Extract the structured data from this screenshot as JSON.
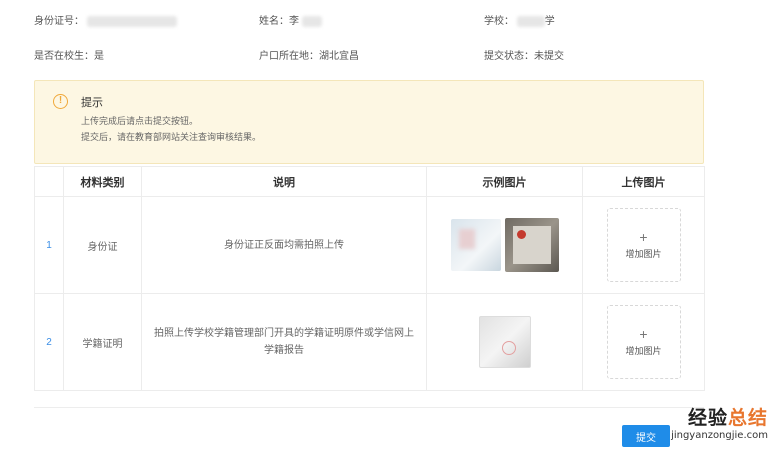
{
  "info": {
    "id_label": "身份证号：",
    "name_label": "姓名：",
    "name_value": "李",
    "school_label": "学校：",
    "school_value": "学",
    "enrolled_label": "是否在校生：",
    "enrolled_value": "是",
    "hukou_label": "户口所在地：",
    "hukou_value": "湖北宜昌",
    "status_label": "提交状态：",
    "status_value": "未提交"
  },
  "notice": {
    "icon": "exclamation-circle-icon",
    "title": "提示",
    "lines": [
      "上传完成后请点击提交按钮。",
      "提交后，请在教育部网站关注查询审核结果。"
    ]
  },
  "table": {
    "headers": [
      "",
      "材料类别",
      "说明",
      "示例图片",
      "上传图片"
    ],
    "rows": [
      {
        "num": "1",
        "category": "身份证",
        "description": "身份证正反面均需拍照上传",
        "upload_plus": "+",
        "upload_label": "增加图片"
      },
      {
        "num": "2",
        "category": "学籍证明",
        "description": "拍照上传学校学籍管理部门开具的学籍证明原件或学信网上学籍报告",
        "upload_plus": "+",
        "upload_label": "增加图片"
      }
    ]
  },
  "submit_label": "提交",
  "watermark": {
    "title_a": "经验",
    "title_b": "总结",
    "url": "jingyanzongjie.com"
  },
  "colors": {
    "accent": "#1f8ce8",
    "notice_bg": "#fdf7e3",
    "warning": "#f0a93b"
  }
}
